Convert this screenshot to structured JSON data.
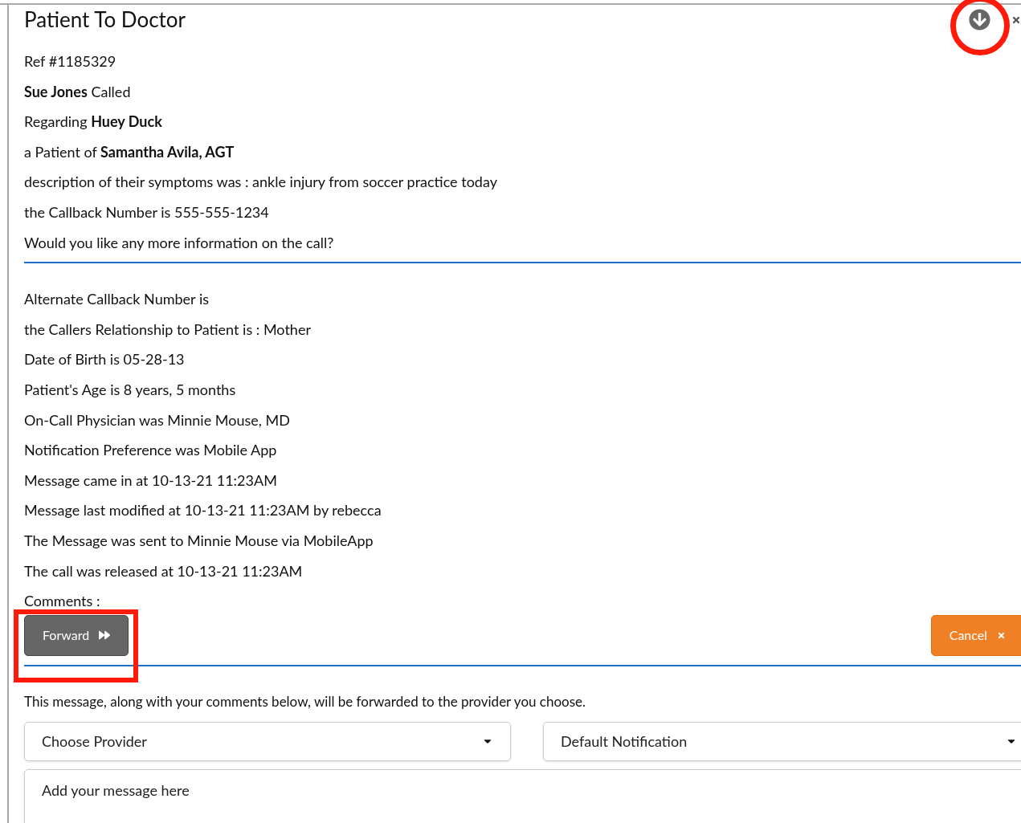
{
  "title": "Patient To Doctor",
  "details": [
    "Ref #1185329",
    "**Sue Jones** Called",
    "Regarding **Huey Duck**",
    "a Patient of **Samantha Avila, AGT**",
    "description of their symptoms was : ankle injury from soccer practice today",
    "the Callback Number is 555-555-1234",
    "Would you like any more information on the call?"
  ],
  "more_details": [
    "Alternate Callback Number is",
    "the Callers Relationship to Patient is : Mother",
    "Date of Birth is 05-28-13",
    "Patient's Age is 8 years, 5 months",
    "On-Call Physician was Minnie Mouse, MD",
    "Notification Preference was Mobile App",
    "Message came in at 10-13-21 11:23AM",
    "Message last modified at 10-13-21 11:23AM by rebecca",
    "The Message was sent to Minnie Mouse via MobileApp",
    "The call was released at 10-13-21 11:23AM",
    "Comments :"
  ],
  "buttons": [
    {
      "label": "Forward",
      "kind": "forward"
    },
    {
      "label": "Cancel",
      "kind": "cancel"
    }
  ],
  "forward_note": "This message, along with your comments below, will be forwarded to the provider you choose.",
  "provider_select": {
    "value": "Choose Provider"
  },
  "notification_select": {
    "value": "Default Notification"
  },
  "message_field": {
    "placeholder": "Add your message here"
  }
}
